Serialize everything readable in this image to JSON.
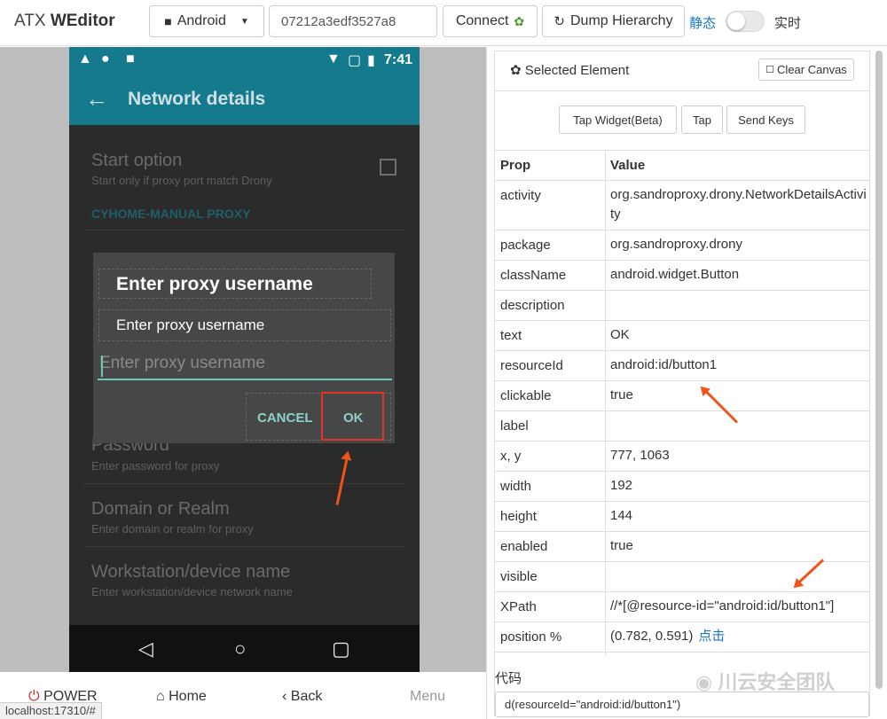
{
  "topbar": {
    "brand_prefix": "ATX",
    "brand_main": "WEditor",
    "platform_select": "Android",
    "device_serial": "07212a3edf3527a8",
    "connect_label": "Connect",
    "dump_label": "Dump Hierarchy",
    "static_label": "静态",
    "realtime_label": "实时",
    "realtime_on": false
  },
  "phone": {
    "status_time": "7:41",
    "app_title": "Network details",
    "list": {
      "start_option_title": "Start option",
      "start_option_sub": "Start only if proxy port match Drony",
      "section": "CYHOME-MANUAL PROXY",
      "password_title": "Password",
      "password_sub": "Enter password for proxy",
      "domain_title": "Domain or Realm",
      "domain_sub": "Enter domain or realm for proxy",
      "workstation_title": "Workstation/device name",
      "workstation_sub": "Enter workstation/device network name"
    },
    "dialog": {
      "title": "Enter proxy username",
      "message": "Enter proxy username",
      "input_placeholder": "Enter proxy username",
      "cancel": "CANCEL",
      "ok": "OK"
    }
  },
  "bottom_controls": {
    "power": "POWER",
    "home": "Home",
    "back": "Back",
    "menu": "Menu",
    "url": "localhost:17310/#"
  },
  "panel": {
    "title": "Selected Element",
    "clear_canvas": "Clear Canvas",
    "tap_widget": "Tap Widget(Beta)",
    "tap": "Tap",
    "send_keys": "Send Keys",
    "col_prop": "Prop",
    "col_value": "Value",
    "rows": [
      {
        "prop": "activity",
        "value": "org.sandroproxy.drony.NetworkDetailsActivity"
      },
      {
        "prop": "package",
        "value": "org.sandroproxy.drony"
      },
      {
        "prop": "className",
        "value": "android.widget.Button"
      },
      {
        "prop": "description",
        "value": ""
      },
      {
        "prop": "text",
        "value": "OK"
      },
      {
        "prop": "resourceId",
        "value": "android:id/button1"
      },
      {
        "prop": "clickable",
        "value": "true"
      },
      {
        "prop": "label",
        "value": ""
      },
      {
        "prop": "x, y",
        "value": "777, 1063"
      },
      {
        "prop": "width",
        "value": "192"
      },
      {
        "prop": "height",
        "value": "144"
      },
      {
        "prop": "enabled",
        "value": "true"
      },
      {
        "prop": "visible",
        "value": ""
      },
      {
        "prop": "XPath",
        "value": "//*[@resource-id=\"android:id/button1\"]"
      },
      {
        "prop": "position %",
        "value": "(0.782, 0.591)",
        "link": "点击"
      }
    ],
    "code_label": "代码",
    "code": "d(resourceId=\"android:id/button1\")"
  },
  "watermark": "川云安全团队",
  "colors": {
    "accent": "#157a8d",
    "link": "#1a78c2",
    "annotation": "#f0531b",
    "highlight": "#e2332b"
  }
}
